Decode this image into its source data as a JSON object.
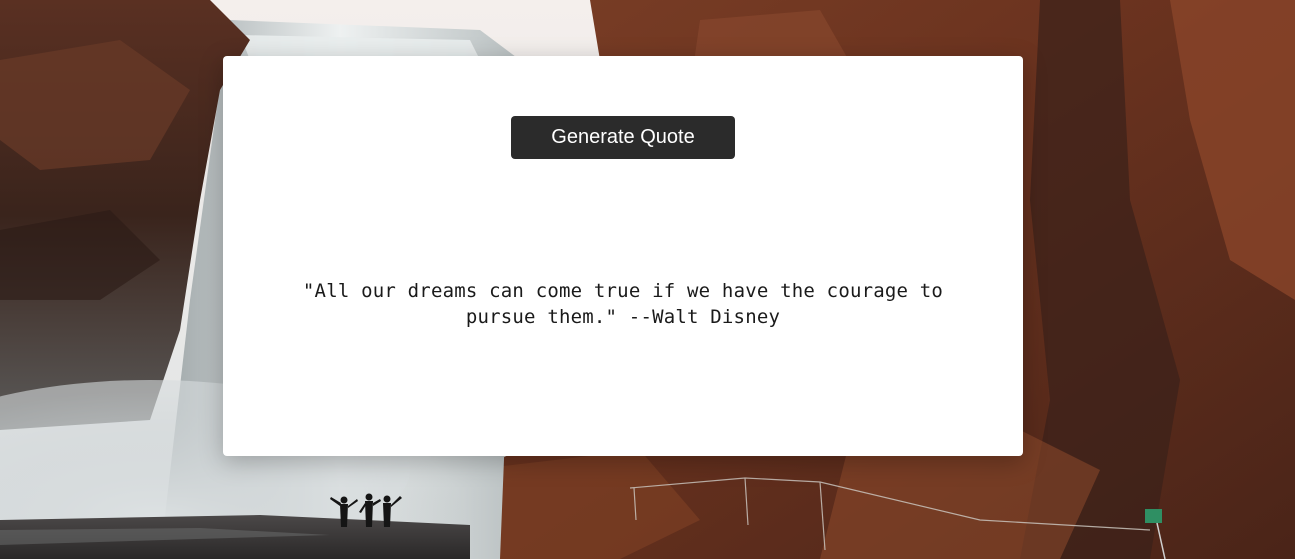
{
  "app": {
    "generate_button_label": "Generate Quote",
    "quote_text": "\"All our dreams can come true if we have the courage to pursue them.\" --Walt Disney"
  },
  "background": {
    "description_icon": "waterfall-landscape",
    "colors": {
      "rock": "#6b3a26",
      "rock_dark": "#2e1a14",
      "mist": "#cfd6d8",
      "sky": "#f1ecea"
    }
  },
  "theme": {
    "card_bg": "#ffffff",
    "button_bg": "#2b2b2b",
    "button_text": "#ffffff",
    "quote_text_color": "#1a1a1a"
  }
}
